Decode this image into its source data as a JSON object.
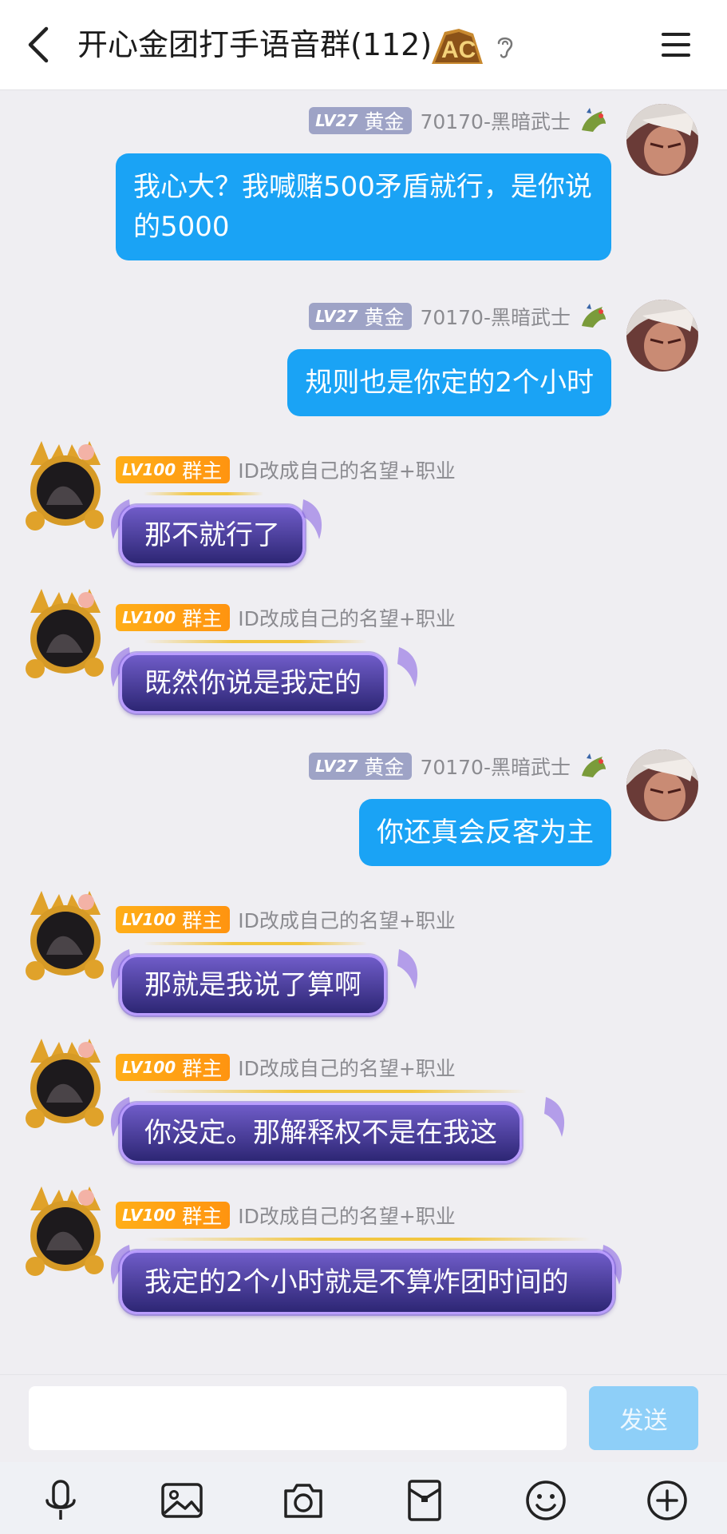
{
  "header": {
    "title": "开心金团打手语音群(112)",
    "back_icon": "back-arrow-icon",
    "menu_icon": "hamburger-menu-icon",
    "rank_badge_text": "AC"
  },
  "messages": [
    {
      "side": "right",
      "level": "LV27",
      "rank": "黄金",
      "nick": "70170-黑暗武士",
      "text": "我心大？我喊赌500矛盾就行，是你说的5000"
    },
    {
      "side": "right",
      "level": "LV27",
      "rank": "黄金",
      "nick": "70170-黑暗武士",
      "text": "规则也是你定的2个小时"
    },
    {
      "side": "left",
      "level": "LV100",
      "rank": "群主",
      "nick": "ID改成自己的名望+职业",
      "text": "那不就行了"
    },
    {
      "side": "left",
      "level": "LV100",
      "rank": "群主",
      "nick": "ID改成自己的名望+职业",
      "text": "既然你说是我定的"
    },
    {
      "side": "right",
      "level": "LV27",
      "rank": "黄金",
      "nick": "70170-黑暗武士",
      "text": "你还真会反客为主"
    },
    {
      "side": "left",
      "level": "LV100",
      "rank": "群主",
      "nick": "ID改成自己的名望+职业",
      "text": "那就是我说了算啊"
    },
    {
      "side": "left",
      "level": "LV100",
      "rank": "群主",
      "nick": "ID改成自己的名望+职业",
      "text": "你没定。那解释权不是在我这"
    },
    {
      "side": "left",
      "level": "LV100",
      "rank": "群主",
      "nick": "ID改成自己的名望+职业",
      "text": "我定的2个小时就是不算炸团时间的"
    }
  ],
  "input": {
    "value": "",
    "send_label": "发送"
  },
  "toolbar": [
    "microphone-icon",
    "image-icon",
    "camera-icon",
    "red-packet-icon",
    "emoji-icon",
    "plus-icon"
  ],
  "colors": {
    "accent_blue": "#1aa3f5",
    "bubble_purple": "#3a2f8a",
    "gold_badge": "#ffa314",
    "grey_badge": "#9ea3c6"
  }
}
